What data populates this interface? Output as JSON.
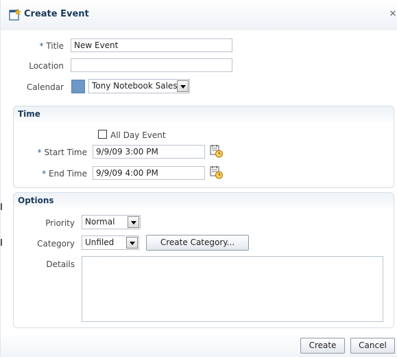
{
  "dialog": {
    "title": "Create Event",
    "close_glyph": "✕"
  },
  "form": {
    "title_label": "Title",
    "title_value": "New Event",
    "location_label": "Location",
    "location_value": "",
    "calendar_label": "Calendar",
    "calendar_color": "#6d98c7",
    "calendar_value": "Tony Notebook Sales",
    "required_marker": "*"
  },
  "time": {
    "section_title": "Time",
    "all_day_label": "All Day Event",
    "all_day_checked": false,
    "start_label": "Start Time",
    "start_value": "9/9/09 3:00 PM",
    "end_label": "End Time",
    "end_value": "9/9/09 4:00 PM",
    "picker_icon": "calendar-clock-icon"
  },
  "options": {
    "section_title": "Options",
    "priority_label": "Priority",
    "priority_value": "Normal",
    "category_label": "Category",
    "category_value": "Unfiled",
    "create_category_label": "Create Category...",
    "details_label": "Details",
    "details_value": ""
  },
  "footer": {
    "create_label": "Create",
    "cancel_label": "Cancel"
  }
}
